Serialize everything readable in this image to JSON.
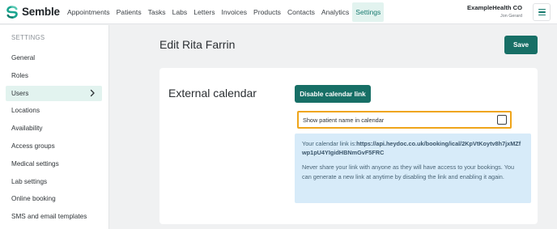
{
  "app": {
    "name": "Semble"
  },
  "nav": {
    "items": [
      {
        "label": "Appointments",
        "name": "nav-appointments"
      },
      {
        "label": "Patients",
        "name": "nav-patients"
      },
      {
        "label": "Tasks",
        "name": "nav-tasks"
      },
      {
        "label": "Labs",
        "name": "nav-labs"
      },
      {
        "label": "Letters",
        "name": "nav-letters"
      },
      {
        "label": "Invoices",
        "name": "nav-invoices"
      },
      {
        "label": "Products",
        "name": "nav-products"
      },
      {
        "label": "Contacts",
        "name": "nav-contacts"
      },
      {
        "label": "Analytics",
        "name": "nav-analytics"
      },
      {
        "label": "Settings",
        "name": "nav-settings",
        "active": true
      }
    ]
  },
  "account": {
    "org": "ExampleHealth CO",
    "user": "Jon Gerard"
  },
  "sidebar": {
    "heading": "SETTINGS",
    "items": [
      {
        "label": "General"
      },
      {
        "label": "Roles"
      },
      {
        "label": "Users",
        "active": true
      },
      {
        "label": "Locations"
      },
      {
        "label": "Availability"
      },
      {
        "label": "Access groups"
      },
      {
        "label": "Medical settings"
      },
      {
        "label": "Lab settings"
      },
      {
        "label": "Online booking"
      },
      {
        "label": "SMS and email templates"
      }
    ]
  },
  "page": {
    "title": "Edit Rita Farrin",
    "save_label": "Save"
  },
  "calendar": {
    "title": "External calendar",
    "disable_label": "Disable calendar link",
    "show_name_label": "Show patient name in calendar",
    "show_name_checked": false,
    "link_prefix": "Your calendar link is:",
    "link_url": "https://api.heydoc.co.uk/booking/ical/2KpVtKoytv8h7jxMZfwp1pU4YIgidHBNmGvF5FRC",
    "warning": "Never share your link with anyone as they will have access to your bookings. You can generate a new link at anytime by disabling the link and enabling it again."
  },
  "colors": {
    "brand": "#176f66",
    "active_bg": "#e2f3ef",
    "highlight": "#efa51a",
    "info_bg": "#d7ebf9"
  }
}
